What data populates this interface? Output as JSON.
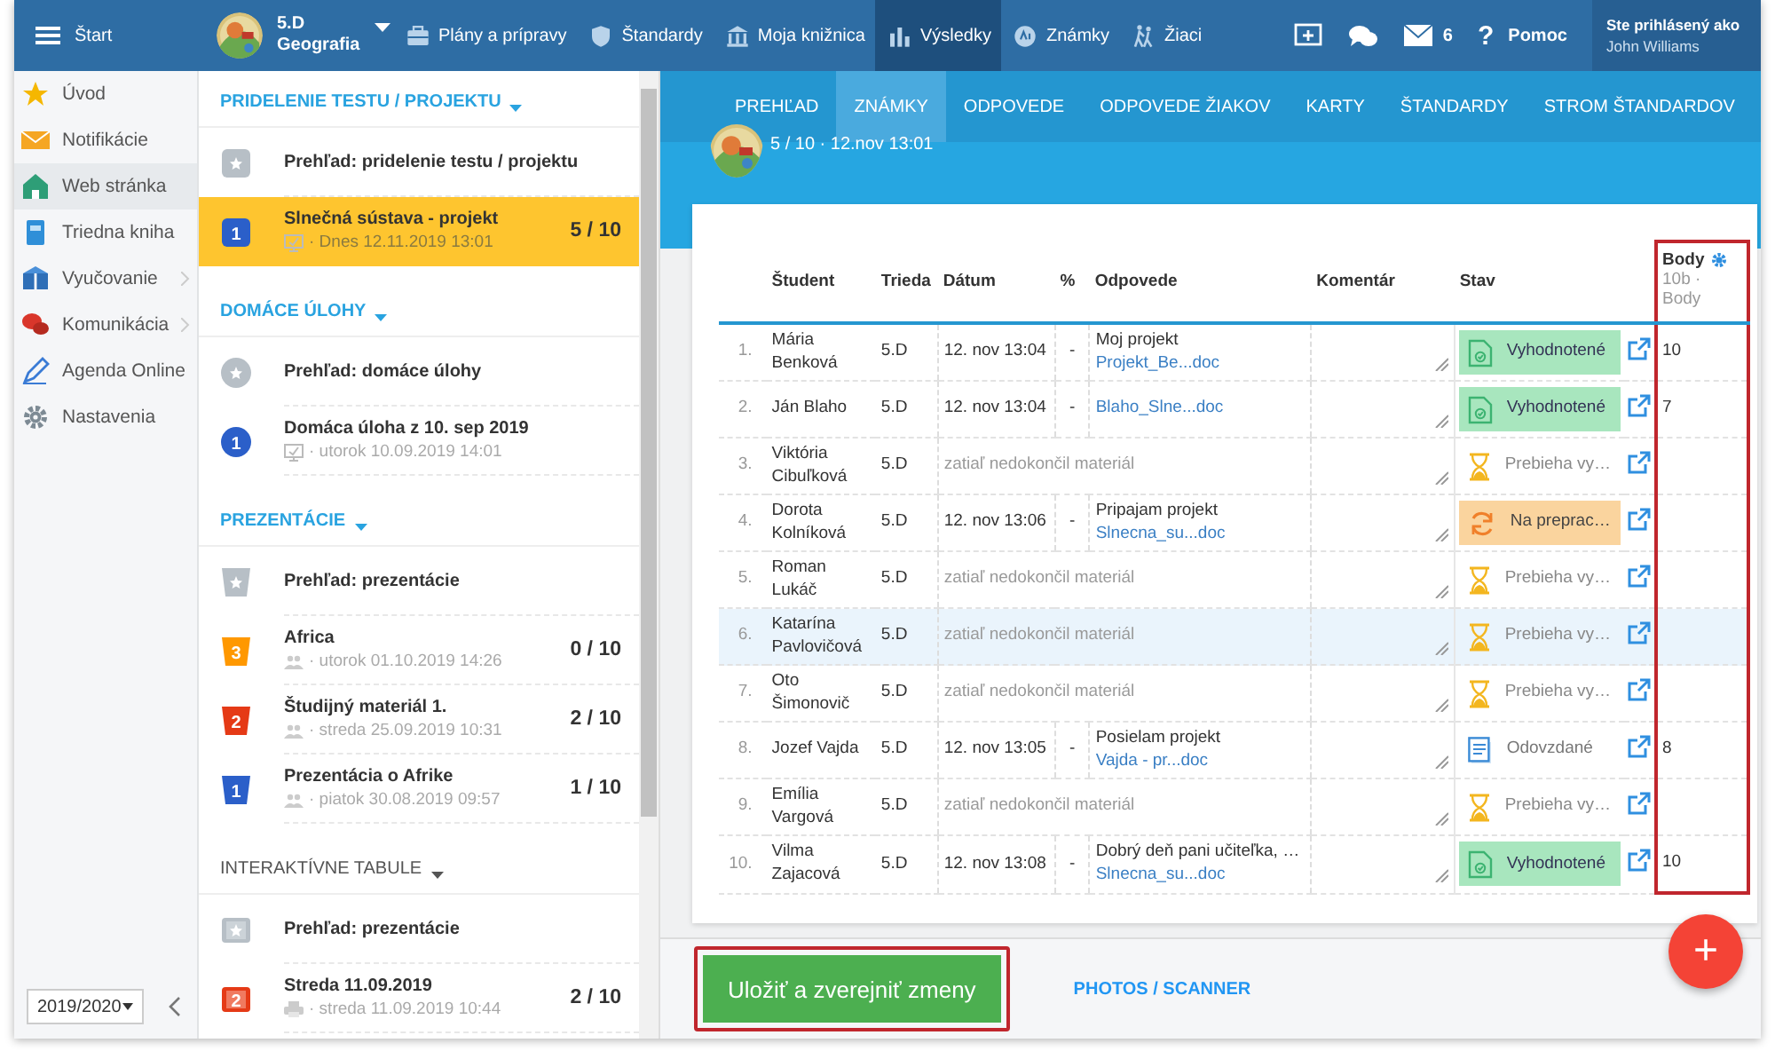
{
  "topbar": {
    "start_label": "Štart",
    "class_name": "5.D",
    "subject": "Geografia",
    "nav": [
      {
        "label": "Plány a prípravy",
        "selected": false
      },
      {
        "label": "Štandardy",
        "selected": false
      },
      {
        "label": "Moja knižnica",
        "selected": false
      },
      {
        "label": "Výsledky",
        "selected": true
      },
      {
        "label": "Známky",
        "selected": false
      },
      {
        "label": "Žiaci",
        "selected": false
      }
    ],
    "mail_count": "6",
    "help_glyph": "?",
    "help_label": "Pomoc",
    "login_caption": "Ste prihlásený ako",
    "user_name": "John Williams"
  },
  "sidebar": {
    "items": [
      {
        "label": "Úvod",
        "selected": false,
        "has_submenu": false
      },
      {
        "label": "Notifikácie",
        "selected": false,
        "has_submenu": false
      },
      {
        "label": "Web stránka",
        "selected": true,
        "has_submenu": false
      },
      {
        "label": "Triedna kniha",
        "selected": false,
        "has_submenu": false
      },
      {
        "label": "Vyučovanie",
        "selected": false,
        "has_submenu": true
      },
      {
        "label": "Komunikácia",
        "selected": false,
        "has_submenu": true
      },
      {
        "label": "Agenda Online",
        "selected": false,
        "has_submenu": false
      },
      {
        "label": "Nastavenia",
        "selected": false,
        "has_submenu": false
      }
    ],
    "school_year": "2019/2020"
  },
  "task_list": {
    "sections": [
      {
        "title": "PRIDELENIE TESTU / PROJEKTU",
        "kind": "test",
        "items": [
          {
            "kind": "overview",
            "title": "Prehľad: pridelenie testu / projektu",
            "selected": false
          },
          {
            "kind": "numbered",
            "number": "1",
            "color": "#2b5fc9",
            "title": "Slnečná sústava - projekt",
            "meta": "· Dnes 12.11.2019 13:01",
            "score": "5 / 10",
            "selected": true
          }
        ]
      },
      {
        "title": "DOMÁCE ÚLOHY",
        "kind": "homework",
        "items": [
          {
            "kind": "overview",
            "title": "Prehľad: domáce úlohy",
            "selected": false
          },
          {
            "kind": "numbered",
            "number": "1",
            "color": "#2b5fc9",
            "title": "Domáca úloha z 10. sep 2019",
            "meta": "· utorok 10.09.2019 14:01",
            "selected": false
          }
        ]
      },
      {
        "title": "PREZENTÁCIE",
        "kind": "presentation",
        "items": [
          {
            "kind": "overview",
            "title": "Prehľad: prezentácie",
            "selected": false
          },
          {
            "kind": "numbered",
            "number": "3",
            "color": "#ff9800",
            "title": "Africa",
            "meta": "· utorok 01.10.2019 14:26",
            "score": "0 / 10",
            "selected": false
          },
          {
            "kind": "numbered",
            "number": "2",
            "color": "#e53a16",
            "title": "Študijný materiál 1.",
            "meta": "· streda 25.09.2019 10:31",
            "score": "2 / 10",
            "selected": false
          },
          {
            "kind": "numbered",
            "number": "1",
            "color": "#2b5fc9",
            "title": "Prezentácia o Afrike",
            "meta": "· piatok 30.08.2019 09:57",
            "score": "1 / 10",
            "selected": false
          }
        ]
      },
      {
        "title": "INTERAKTÍVNE TABULE",
        "kind": "board",
        "items": [
          {
            "kind": "overview",
            "title": "Prehľad: prezentácie",
            "selected": false
          },
          {
            "kind": "numbered",
            "number": "2",
            "color": "#e53a16",
            "title": "Streda 11.09.2019",
            "meta": "· streda 11.09.2019 10:44",
            "score": "2 / 10",
            "selected": false
          }
        ]
      }
    ]
  },
  "tabs": [
    {
      "label": "PREHĽAD",
      "selected": false
    },
    {
      "label": "ZNÁMKY",
      "selected": true
    },
    {
      "label": "ODPOVEDE",
      "selected": false
    },
    {
      "label": "ODPOVEDE ŽIAKOV",
      "selected": false
    },
    {
      "label": "KARTY",
      "selected": false
    },
    {
      "label": "ŠTANDARDY",
      "selected": false
    },
    {
      "label": "STROM ŠTANDARDOV",
      "selected": false
    }
  ],
  "assignment": {
    "summary": "5 / 10 · 12.nov 13:01"
  },
  "table": {
    "columns": [
      "Študent",
      "Trieda",
      "Dátum",
      "%",
      "Odpovede",
      "Komentár",
      "Stav"
    ],
    "points_column": {
      "title": "Body",
      "subtitle": "10b · Body",
      "highlighted": true
    },
    "rows": [
      {
        "number": "1.",
        "student": "Mária Benková",
        "class": "5.D",
        "date": "12. nov 13:04",
        "percent": "-",
        "response_text": "Moj projekt",
        "response_file": "Projekt_Be...doc",
        "status": {
          "kind": "evaluated",
          "label": "Vyhodnotené"
        },
        "points": "10",
        "selected": false
      },
      {
        "number": "2.",
        "student": "Ján Blaho",
        "class": "5.D",
        "date": "12. nov 13:04",
        "percent": "-",
        "response_file": "Blaho_Slne...doc",
        "status": {
          "kind": "evaluated",
          "label": "Vyhodnotené"
        },
        "points": "7",
        "selected": false
      },
      {
        "number": "3.",
        "student": "Viktória Cibuľková",
        "class": "5.D",
        "pending_note": "zatiaľ nedokončil materiál",
        "status": {
          "kind": "in_progress",
          "label": "Prebieha vy…"
        },
        "selected": false
      },
      {
        "number": "4.",
        "student": "Dorota Kolníková",
        "class": "5.D",
        "date": "12. nov 13:06",
        "percent": "-",
        "response_text": "Pripajam projekt",
        "response_file": "Slnecna_su...doc",
        "status": {
          "kind": "rework",
          "label": "Na preprac…"
        },
        "selected": false
      },
      {
        "number": "5.",
        "student": "Roman Lukáč",
        "class": "5.D",
        "pending_note": "zatiaľ nedokončil materiál",
        "status": {
          "kind": "in_progress",
          "label": "Prebieha vy…"
        },
        "selected": false
      },
      {
        "number": "6.",
        "student": "Katarína Pavlovičová",
        "class": "5.D",
        "pending_note": "zatiaľ nedokončil materiál",
        "status": {
          "kind": "in_progress",
          "label": "Prebieha vy…"
        },
        "selected": true
      },
      {
        "number": "7.",
        "student": "Oto Šimonovič",
        "class": "5.D",
        "pending_note": "zatiaľ nedokončil materiál",
        "status": {
          "kind": "in_progress",
          "label": "Prebieha vy…"
        },
        "selected": false
      },
      {
        "number": "8.",
        "student": "Jozef Vajda",
        "class": "5.D",
        "date": "12. nov 13:05",
        "percent": "-",
        "response_text": "Posielam projekt",
        "response_file": "Vajda - pr...doc",
        "status": {
          "kind": "submitted",
          "label": "Odovzdané"
        },
        "points": "8",
        "selected": false
      },
      {
        "number": "9.",
        "student": "Emília Vargová",
        "class": "5.D",
        "pending_note": "zatiaľ nedokončil materiál",
        "status": {
          "kind": "in_progress",
          "label": "Prebieha vy…"
        },
        "selected": false
      },
      {
        "number": "10.",
        "student": "Vilma Zajacová",
        "class": "5.D",
        "date": "12. nov 13:08",
        "percent": "-",
        "response_text": "Dobrý deň pani učiteľka, …",
        "response_file": "Slnecna_su...doc",
        "status": {
          "kind": "evaluated",
          "label": "Vyhodnotené"
        },
        "points": "10",
        "selected": false
      }
    ]
  },
  "footer": {
    "save_label": "Uložiť a zverejniť zmeny",
    "save_highlighted": true,
    "link_label": "PHOTOS / SCANNER"
  },
  "fab": {
    "label": "+"
  }
}
